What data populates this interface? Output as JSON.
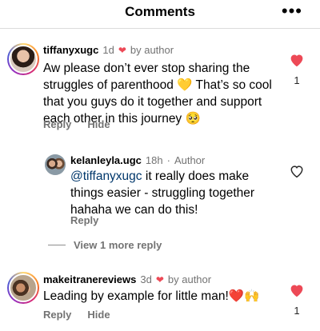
{
  "header": {
    "title": "Comments",
    "more_label": "•••"
  },
  "comments": [
    {
      "username": "tiffanyxugc",
      "time": "1d",
      "tag": "by author",
      "text_before": "Aw please don’t ever stop sharing the struggles of parenthood 💛 That’s so cool that you guys do it together and support each other in this journey 🥺",
      "reply_label": "Reply",
      "hide_label": "Hide",
      "like_count": "1"
    },
    {
      "username": "kelanleyla.ugc",
      "time": "18h",
      "tag": "Author",
      "mention": "@tiffanyxugc",
      "text": " it really does make things easier - struggling together hahaha we can do this!",
      "reply_label": "Reply"
    },
    {
      "username": "makeitranereviews",
      "time": "3d",
      "tag": "by author",
      "text": "Leading by example for little man!❤️🙌",
      "reply_label": "Reply",
      "hide_label": "Hide",
      "like_count": "1"
    }
  ],
  "view_more": "View 1 more reply",
  "colors": {
    "heart": "#ed4956",
    "mention": "#00376b",
    "muted": "#737373"
  }
}
